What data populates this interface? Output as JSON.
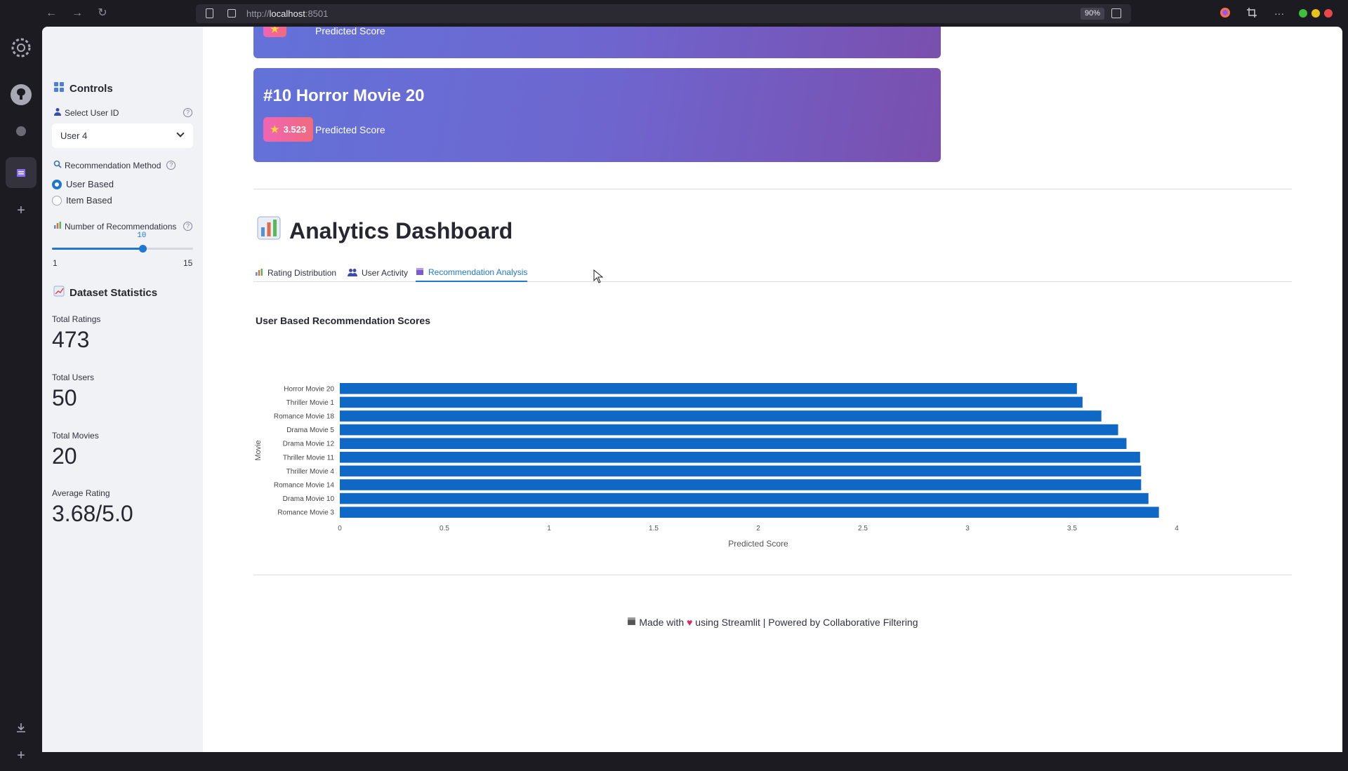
{
  "browser": {
    "url_prefix": "http://",
    "url_host": "localhost",
    "url_suffix": ":8501",
    "zoom": "90%"
  },
  "sidebar": {
    "controls_title": "Controls",
    "select_user_label": "Select User ID",
    "selected_user": "User 4",
    "method_label": "Recommendation Method",
    "method_options": [
      "User Based",
      "Item Based"
    ],
    "method_selected": "User Based",
    "num_recs_label": "Number of Recommendations",
    "num_recs_value": "10",
    "num_recs_min": "1",
    "num_recs_max": "15",
    "dataset_title": "Dataset Statistics",
    "metrics": [
      {
        "label": "Total Ratings",
        "value": "473"
      },
      {
        "label": "Total Users",
        "value": "50"
      },
      {
        "label": "Total Movies",
        "value": "20"
      },
      {
        "label": "Average Rating",
        "value": "3.68/5.0"
      }
    ]
  },
  "cards": {
    "prev_label": "Predicted Score",
    "last": {
      "title": "#10 Horror Movie 20",
      "score": "3.523",
      "score_label": "Predicted Score"
    }
  },
  "analytics": {
    "title": "Analytics Dashboard",
    "tabs": [
      "Rating Distribution",
      "User Activity",
      "Recommendation Analysis"
    ],
    "active_tab": "Recommendation Analysis"
  },
  "chart_data": {
    "type": "bar",
    "orientation": "horizontal",
    "title": "User Based Recommendation Scores",
    "xlabel": "Predicted Score",
    "ylabel": "Movie",
    "categories": [
      "Horror Movie 20",
      "Thriller Movie 1",
      "Romance Movie 18",
      "Drama Movie 5",
      "Drama Movie 12",
      "Thriller Movie 11",
      "Thriller Movie 4",
      "Romance Movie 14",
      "Drama Movie 10",
      "Romance Movie 3"
    ],
    "values": [
      3.523,
      3.55,
      3.64,
      3.72,
      3.76,
      3.825,
      3.83,
      3.83,
      3.865,
      3.915
    ],
    "xlim": [
      0,
      4
    ],
    "xticks": [
      "0",
      "0.5",
      "1",
      "1.5",
      "2",
      "2.5",
      "3",
      "3.5",
      "4"
    ],
    "bar_color": "#0f67c6"
  },
  "footer": {
    "text_before": "Made with",
    "text_after": "using Streamlit | Powered by Collaborative Filtering"
  }
}
